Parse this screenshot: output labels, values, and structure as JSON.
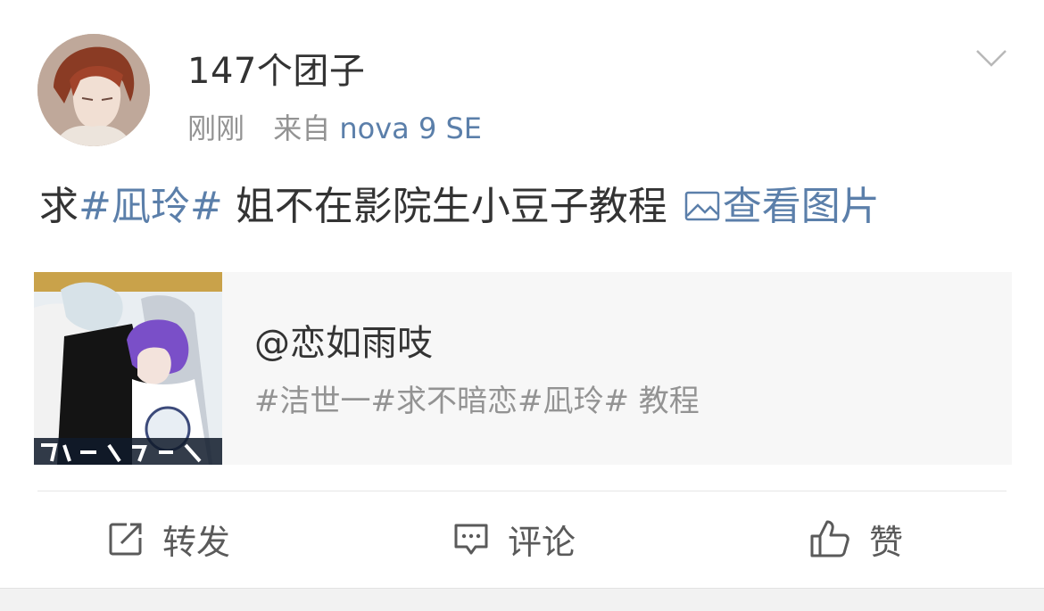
{
  "post": {
    "username": "147个团子",
    "time": "刚刚",
    "source_prefix": "来自",
    "device": "nova 9 SE",
    "content": {
      "prefix": "求",
      "topic": "#凪玲#",
      "text": " 姐不在影院生小豆子教程 ",
      "view_image": "查看图片"
    }
  },
  "repost_card": {
    "author": "@恋如雨吱",
    "description": "#洁世一#求不暗恋#凪玲# 教程"
  },
  "actions": {
    "repost": "转发",
    "comment": "评论",
    "like": "赞"
  },
  "icons": {
    "more": "chevron-down-icon",
    "image": "image-icon",
    "repost": "repost-icon",
    "comment": "comment-icon",
    "like": "thumbs-up-icon"
  },
  "colors": {
    "link": "#5b7faa",
    "text": "#333333",
    "secondary": "#939393",
    "card_bg": "#f7f7f7"
  }
}
